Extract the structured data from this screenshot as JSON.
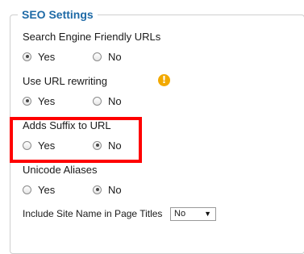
{
  "legend": "SEO Settings",
  "fields": [
    {
      "label": "Search Engine Friendly URLs",
      "options": [
        {
          "label": "Yes",
          "checked": true
        },
        {
          "label": "No",
          "checked": false
        }
      ]
    },
    {
      "label": "Use URL rewriting",
      "warning_icon": "!",
      "options": [
        {
          "label": "Yes",
          "checked": true
        },
        {
          "label": "No",
          "checked": false
        }
      ]
    },
    {
      "label": "Adds Suffix to URL",
      "options": [
        {
          "label": "Yes",
          "checked": false
        },
        {
          "label": "No",
          "checked": true
        }
      ]
    },
    {
      "label": "Unicode Aliases",
      "options": [
        {
          "label": "Yes",
          "checked": false
        },
        {
          "label": "No",
          "checked": true
        }
      ]
    }
  ],
  "site_name": {
    "label": "Include Site Name in Page Titles",
    "selected": "No",
    "arrow": "▼"
  },
  "colors": {
    "legend": "#1e6aa6",
    "highlight": "#ff0000",
    "warning": "#f2a900"
  }
}
